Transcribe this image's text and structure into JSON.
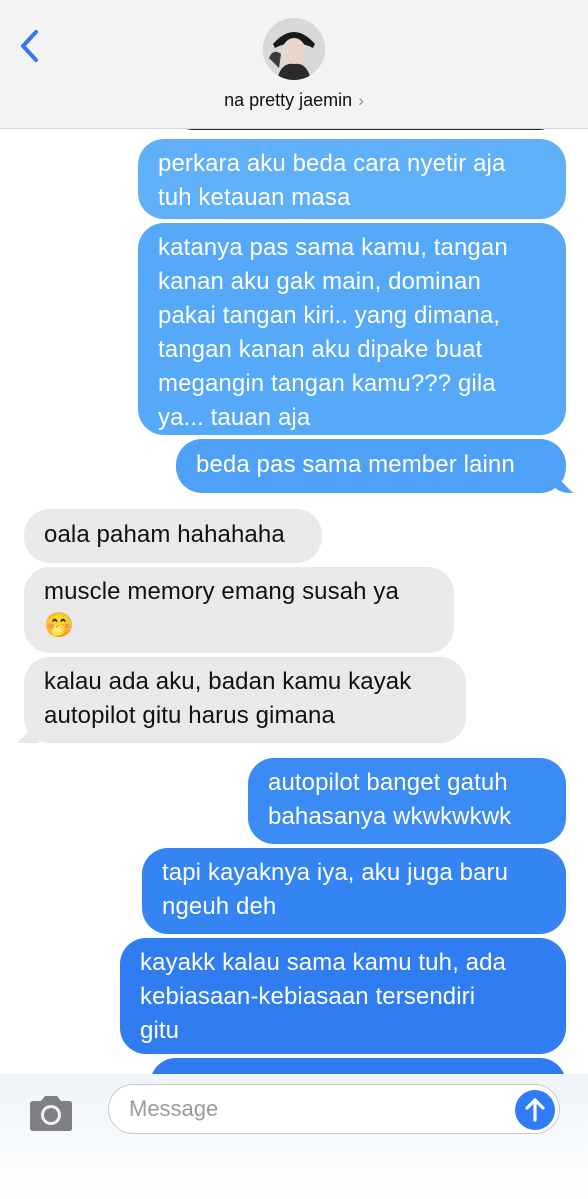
{
  "header": {
    "contact_name": "na pretty jaemin",
    "back_icon": "chevron-left-icon",
    "disclosure_icon": "chevron-right-icon",
    "accent": "#3478f6"
  },
  "messages": [
    {
      "from": "me",
      "lines": [
        "perkara aku beda cara nyetir aja",
        "tuh ketauan masa"
      ]
    },
    {
      "from": "me",
      "lines": [
        "katanya pas sama kamu, tangan",
        "kanan aku gak main, dominan",
        "pakai tangan kiri.. yang dimana,",
        "tangan kanan aku dipake buat",
        "megangin tangan kamu??? gila",
        "ya... tauan aja"
      ]
    },
    {
      "from": "me",
      "lines": [
        "beda pas sama member lainn"
      ]
    },
    {
      "from": "them",
      "lines": [
        "oala paham hahahaha"
      ]
    },
    {
      "from": "them",
      "lines": [
        "muscle memory emang susah ya",
        "🤭"
      ]
    },
    {
      "from": "them",
      "lines": [
        "kalau ada aku, badan kamu kayak",
        "autopilot gitu harus gimana"
      ]
    },
    {
      "from": "me",
      "lines": [
        "autopilot banget gatuh",
        "bahasanya wkwkwkwk"
      ]
    },
    {
      "from": "me",
      "lines": [
        "tapi kayaknya iya, aku juga baru",
        "ngeuh deh"
      ]
    },
    {
      "from": "me",
      "lines": [
        "kayakk kalau sama kamu tuh, ada",
        "kebiasaan-kebiasaan tersendiri",
        "gitu"
      ]
    }
  ],
  "composer": {
    "placeholder": "Message",
    "camera_icon": "camera-icon",
    "send_icon": "send-arrow-icon"
  },
  "colors": {
    "outgoing_top": "#62b2f9",
    "outgoing_bottom": "#2f7af0",
    "incoming": "#e9e9eb"
  }
}
